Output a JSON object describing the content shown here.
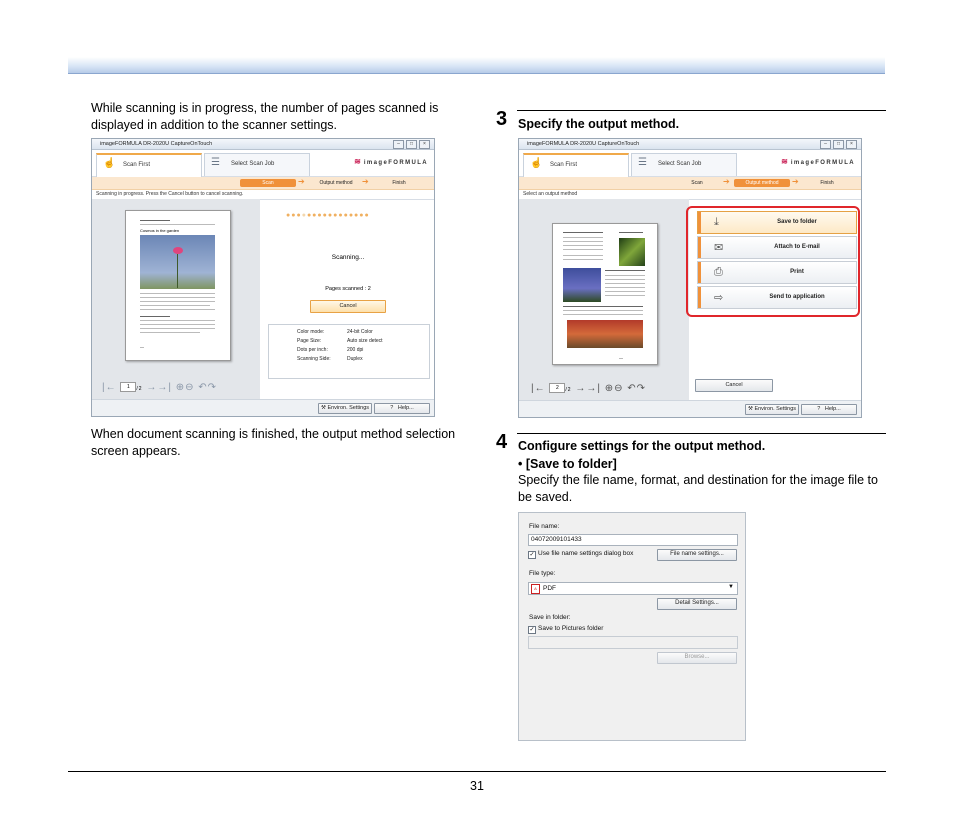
{
  "left_col": {
    "intro_text": "While scanning is in progress, the number of pages scanned is displayed in addition to the scanner settings.",
    "after_text": "When document scanning is finished, the output method selection screen appears."
  },
  "step3": {
    "number": "3",
    "heading": "Specify the output method."
  },
  "step4": {
    "number": "4",
    "heading": "Configure settings for the output method.",
    "bullet": "• [Save to folder]",
    "body": "Specify the file name, format, and destination for the image file to be saved."
  },
  "screen_common": {
    "window_title": "imageFORMULA DR-2020U CaptureOnTouch",
    "tab_scan_first": "Scan First",
    "tab_select_job": "Select Scan Job",
    "brand": "imageFORMULA",
    "step_scan": "Scan",
    "step_output": "Output method",
    "step_finish": "Finish",
    "env_settings": "Environ. Settings",
    "help_q": "?",
    "help": "Help...",
    "thumb_caption": "Cosmos in the garden"
  },
  "screen1": {
    "message": "Scanning in progress. Press the Cancel button to cancel scanning.",
    "scanning": "Scanning...",
    "pages_scanned": "Pages scanned : 2",
    "cancel": "Cancel",
    "page_box": "1",
    "page_total": "/2",
    "settings": [
      {
        "label": "Color mode:",
        "value": "24-bit Color"
      },
      {
        "label": "Page Size:",
        "value": "Auto size detect"
      },
      {
        "label": "Dots per inch:",
        "value": "200 dpi"
      },
      {
        "label": "Scanning Side:",
        "value": "Duplex"
      }
    ],
    "progress_filled": 3,
    "progress_total": 16
  },
  "screen2": {
    "message": "Select an output method",
    "page_box": "2",
    "page_total": "/2",
    "cancel": "Cancel",
    "outputs": [
      {
        "label": "Save to folder",
        "icon": "folder-save-icon",
        "glyph": "⤓"
      },
      {
        "label": "Attach to E-mail",
        "icon": "email-attach-icon",
        "glyph": "✉"
      },
      {
        "label": "Print",
        "icon": "printer-icon",
        "glyph": "⎙"
      },
      {
        "label": "Send to application",
        "icon": "send-app-icon",
        "glyph": "⇨"
      }
    ]
  },
  "dialog": {
    "file_name_label": "File name:",
    "file_name_value": "04072009101433",
    "use_settings": "Use file name settings dialog box",
    "file_name_settings_btn": "File name settings...",
    "file_type_label": "File type:",
    "file_type_value": "PDF",
    "detail_settings_btn": "Detail Settings...",
    "save_in_folder_label": "Save in folder:",
    "save_pictures": "Save to Pictures folder",
    "browse_btn": "Browse...",
    "check": "✓"
  },
  "page_number": "31"
}
